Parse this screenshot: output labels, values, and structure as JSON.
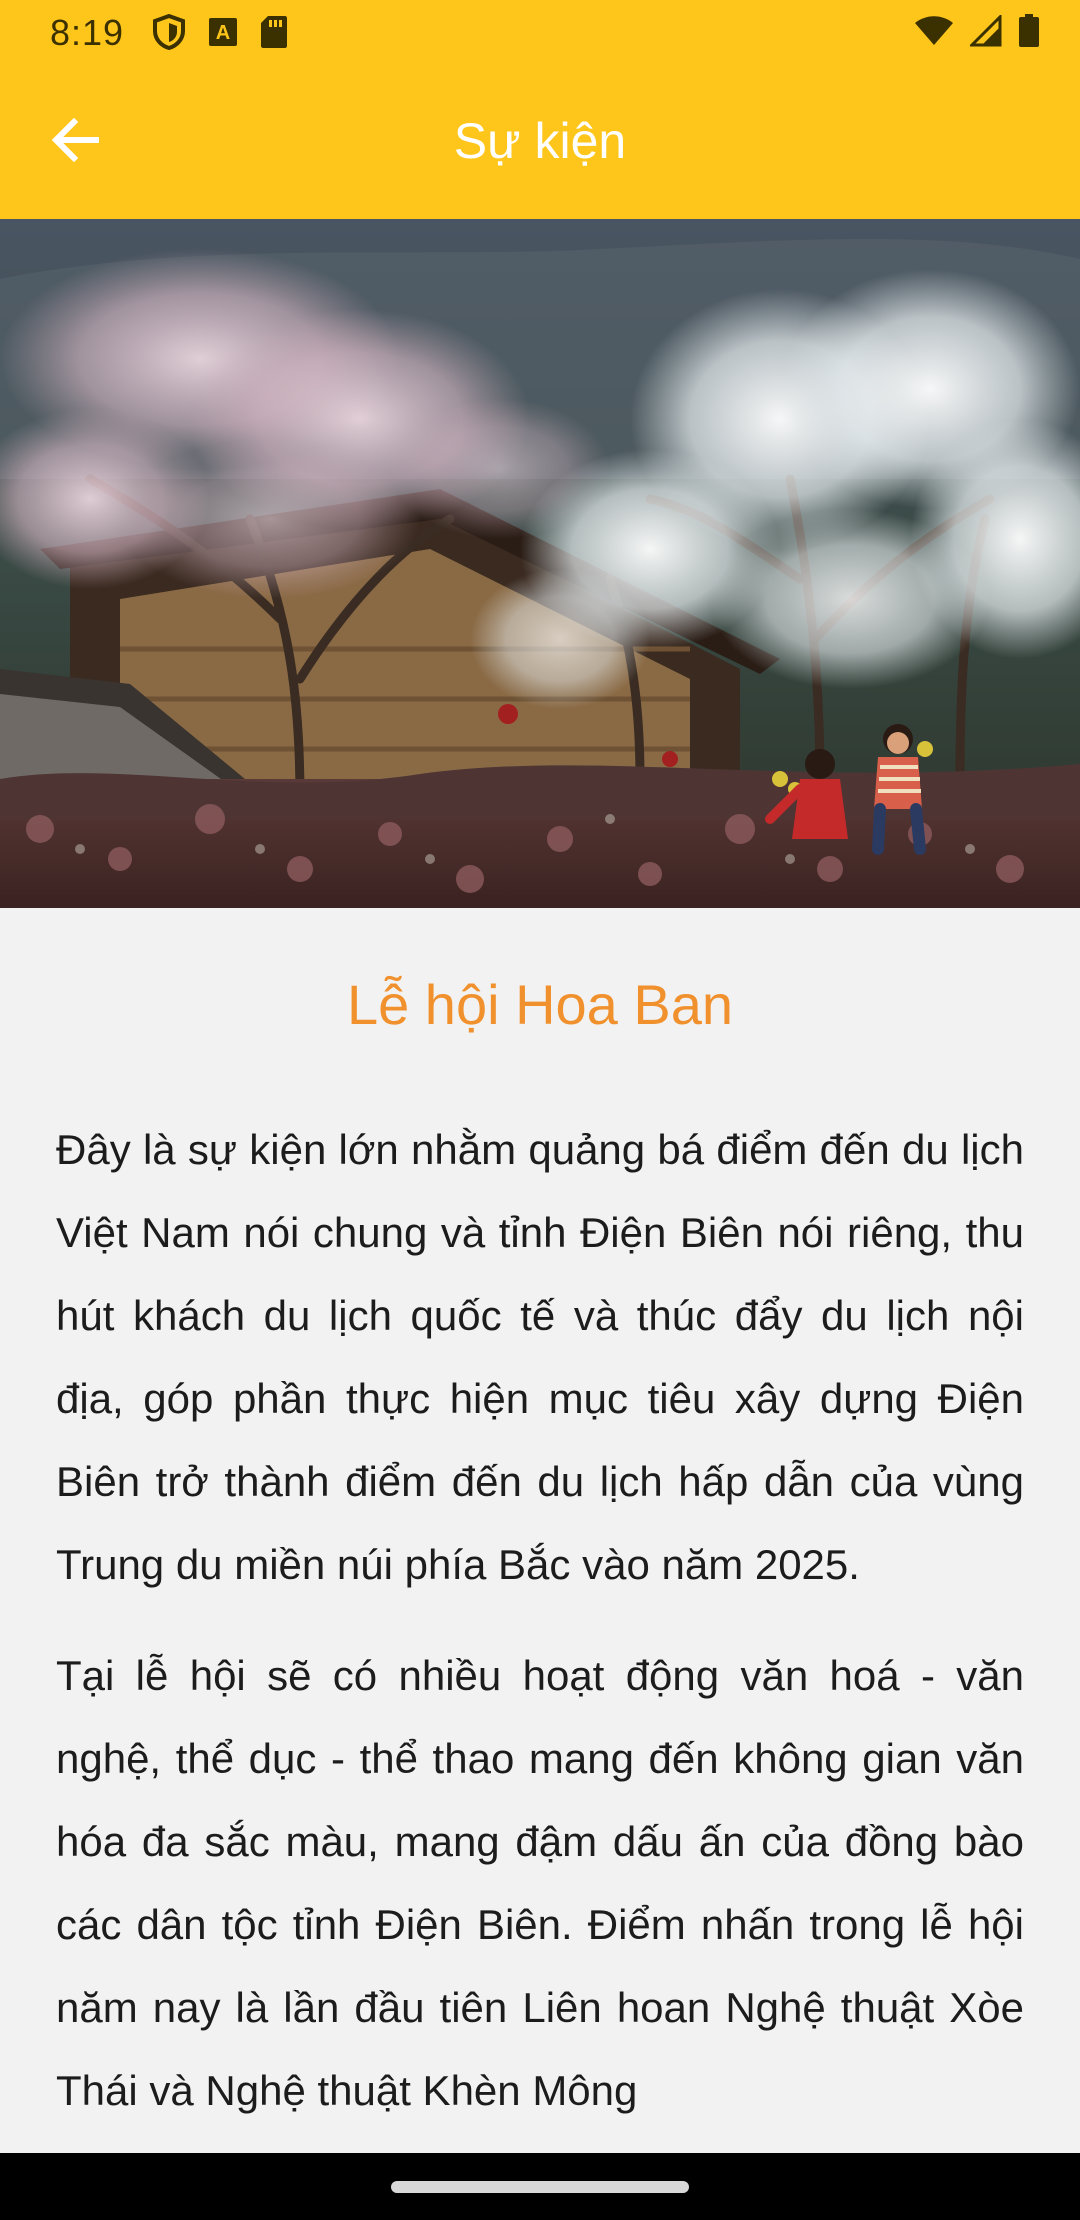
{
  "status_bar": {
    "time": "8:19",
    "left_icons": [
      "shield-icon",
      "text-a-icon",
      "sd-card-icon"
    ],
    "right_icons": [
      "wifi-icon",
      "cell-signal-icon",
      "battery-icon"
    ]
  },
  "toolbar": {
    "back_icon": "arrow-left-icon",
    "title": "Sự kiện",
    "background": "#fec51a"
  },
  "hero_image": {
    "subject": "photo"
  },
  "event": {
    "title": "Lễ hội Hoa Ban",
    "title_color": "#f0912e",
    "paragraphs": [
      "Đây là sự kiện lớn nhằm quảng bá điểm đến du lịch Việt Nam nói chung và tỉnh Điện Biên nói riêng, thu hút khách du lịch quốc tế và thúc đẩy du lịch nội địa, góp phần thực hiện mục tiêu xây dựng Điện Biên trở thành điểm đến du lịch hấp dẫn của vùng Trung du miền núi phía Bắc vào năm 2025.",
      "Tại lễ hội sẽ có nhiều hoạt động văn hoá - văn nghệ, thể dục - thể thao mang đến không gian văn hóa đa sắc màu, mang đậm dấu ấn của đồng bào các dân tộc tỉnh Điện Biên. Điểm nhấn trong lễ hội năm nay là lần đầu tiên Liên hoan Nghệ thuật Xòe Thái và Nghệ thuật Khèn Mông"
    ]
  },
  "nav_bar": {
    "handle": "home-handle"
  }
}
